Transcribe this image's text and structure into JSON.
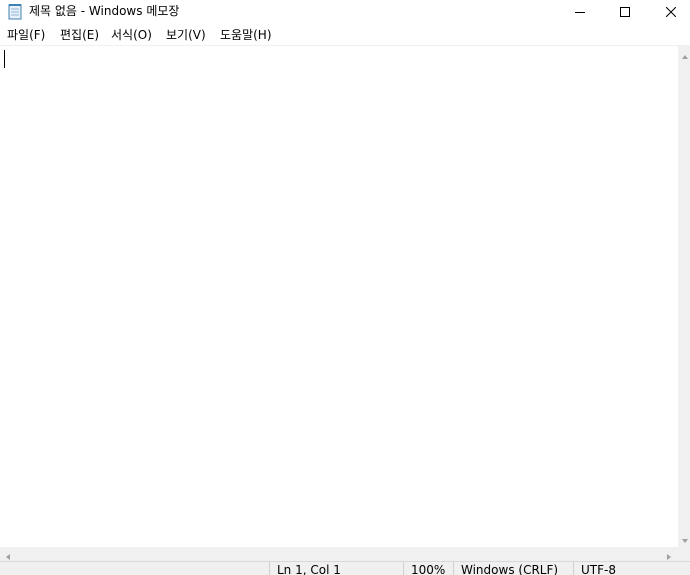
{
  "window": {
    "title": "제목 없음 - Windows 메모장",
    "app_icon": "notepad-icon",
    "controls": {
      "minimize_icon": "minimize-icon",
      "maximize_icon": "maximize-icon",
      "close_icon": "close-icon"
    }
  },
  "menu": {
    "items": [
      {
        "label": "파일(F)"
      },
      {
        "label": "편집(E)"
      },
      {
        "label": "서식(O)"
      },
      {
        "label": "보기(V)"
      },
      {
        "label": "도움말(H)"
      }
    ]
  },
  "editor": {
    "content": ""
  },
  "statusbar": {
    "position": "Ln 1, Col 1",
    "zoom": "100%",
    "line_ending": "Windows (CRLF)",
    "encoding": "UTF-8"
  },
  "colors": {
    "chrome": "#f0f0f0",
    "background": "#ffffff",
    "text": "#000000"
  }
}
